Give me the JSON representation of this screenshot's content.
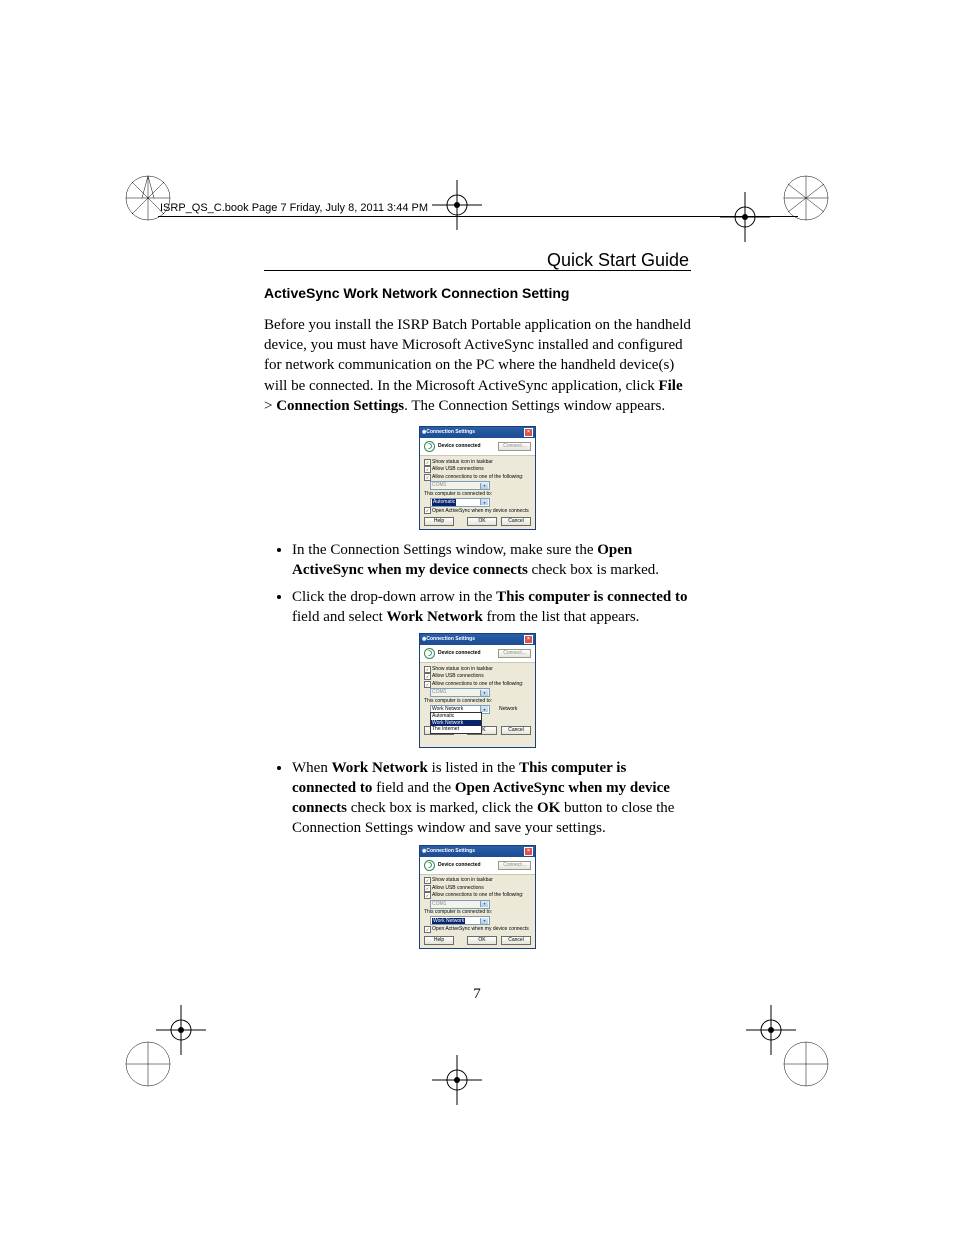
{
  "meta": {
    "line": "ISRP_QS_C.book  Page 7  Friday, July 8, 2011  3:44 PM"
  },
  "header": {
    "title": "Quick Start Guide"
  },
  "section": {
    "heading": "ActiveSync Work Network Connection Setting"
  },
  "intro": {
    "t1": "Before you install the ISRP Batch Portable application on the handheld device, you must have Microsoft ActiveSync installed and configured for network communication on the PC where the handheld device(s) will be connected. In the Microsoft ActiveSync application, click ",
    "file": "File",
    "gt": " > ",
    "cs": "Connection Settings",
    "t2": ". The Connection Settings window appears."
  },
  "bullets1": {
    "a1": "In the Connection Settings window, make sure the ",
    "a_bold": "Open ActiveSync when my device connects",
    "a2": " check box is marked.",
    "b1": "Click the drop-down arrow in the ",
    "b_bold": "This computer is connected to",
    "b2": " field and select ",
    "b_bold2": "Work Network",
    "b3": " from the list that appears."
  },
  "bullets2": {
    "a1": "When ",
    "a_b1": "Work Network",
    "a2": " is listed in the ",
    "a_b2": "This computer is connected to",
    "a3": " field and the ",
    "a_b3": "Open ActiveSync when my device connects",
    "a4": " check box is marked, click the ",
    "a_b4": "OK",
    "a5": " button to close the Connection Settings window and save your settings."
  },
  "dialog": {
    "title": "Connection Settings",
    "device": "Device connected",
    "connect_btn": "Connect...",
    "show_status": "Show status icon in taskbar",
    "allow_usb": "Allow USB connections",
    "allow_conn": "Allow connections to one of the following:",
    "com": "COM1",
    "connected_to_label": "This computer is connected to:",
    "automatic": "Automatic",
    "work_network": "Work Network",
    "the_internet": "The Internet",
    "open_on_connect": "Open ActiveSync when my device connects",
    "help": "Help",
    "ok": "OK",
    "cancel": "Cancel",
    "network": "Network"
  },
  "page_number": "7"
}
